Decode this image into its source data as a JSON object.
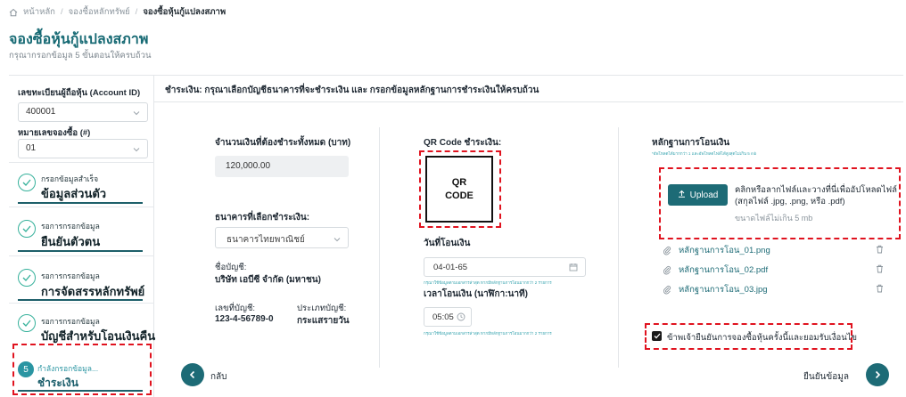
{
  "breadcrumb": {
    "home": "หน้าหลัก",
    "level2": "จองซื้อหลักทรัพย์",
    "current": "จองซื้อหุ้นกู้แปลงสภาพ"
  },
  "page": {
    "title": "จองซื้อหุ้นกู้แปลงสภาพ",
    "subtitle": "กรุณากรอกข้อมูล 5 ขั้นตอนให้ครบถ้วน"
  },
  "sidebar": {
    "account_label": "เลขทะเบียนผู้ถือหุ้น (Account ID)",
    "account_value": "400001",
    "order_label": "หมายเลขจองซื้อ (#)",
    "order_value": "01",
    "steps": [
      {
        "small": "กรอกข้อมูลสำเร็จ",
        "big": "ข้อมูลส่วนตัว"
      },
      {
        "small": "รอการกรอกข้อมูล",
        "big": "ยืนยันตัวตน"
      },
      {
        "small": "รอการกรอกข้อมูล",
        "big": "การจัดสรรหลักทรัพย์"
      },
      {
        "small": "รอการกรอกข้อมูล",
        "big": "บัญชีสำหรับโอนเงินคืน"
      }
    ],
    "active_step": {
      "number": "5",
      "small": "กำลังกรอกข้อมูล...",
      "big": "ชำระเงิน"
    }
  },
  "content": {
    "header": "ชำระเงิน: กรุณาเลือกบัญชีธนาคารที่จะชำระเงิน และ กรอกข้อมูลหลักฐานการชำระเงินให้ครบถ้วน",
    "amount_label": "จำนวนเงินที่ต้องชำระทั้งหมด (บาท)",
    "amount_value": "120,000.00",
    "bank_label": "ธนาคารที่เลือกชำระเงิน:",
    "bank_value": "ธนาคารไทยพาณิชย์",
    "account_name_label": "ชื่อบัญชี:",
    "account_name_value": "บริษัท เอบีซี จำกัด (มหาชน)",
    "account_no_label": "เลขที่บัญชี:",
    "account_no_value": "123-4-56789-0",
    "account_type_label": "ประเภทบัญชี:",
    "account_type_value": "กระแสรายวัน",
    "qr_label": "QR Code ชำระเงิน:",
    "qr_line1": "QR",
    "qr_line2": "CODE",
    "transfer_date_label": "วันที่โอนเงิน",
    "transfer_date_value": "04-01-65",
    "transfer_date_hint": "กรุณาใช้ข้อมูลตามเอกสารล่าสุด หากมีหลักฐานการโอนมากกว่า 2 รายการ",
    "transfer_time_label": "เวลาโอนเงิน (นาฬิกา:นาที)",
    "transfer_time_value": "05:05",
    "transfer_time_hint": "กรุณาใช้ข้อมูลตามเอกสารล่าสุด หากมีหลักฐานการโอนมากกว่า 2 รายการ",
    "evidence_label": "หลักฐานการโอนเงิน",
    "evidence_hint": "*อัพโหลดได้มากกว่า 1 และอัพโหลดไฟล์ได้สูงสุดไม่เกิน 5 mb",
    "upload_button": "Upload",
    "upload_text_1": "คลิกหรือลากไฟล์และวางที่นี่เพื่ออัปโหลดไฟล์",
    "upload_text_2": "(สกุลไฟล์ .jpg, .png, หรือ .pdf)",
    "upload_limit": "ขนาดไฟล์ไม่เกิน 5 mb",
    "files": [
      "หลักฐานการโอน_01.png",
      "หลักฐานการโอน_02.pdf",
      "หลักฐานการโอน_03.jpg"
    ],
    "confirm_text": "ข้าพเจ้ายืนยันการจองซื้อหุ้นครั้งนี้และยอมรับเงื่อนไข",
    "back_label": "กลับ",
    "next_label": "ยืนยันข้อมูล"
  },
  "colors": {
    "primary": "#1d6b76",
    "title": "#176a74",
    "success": "#36b19b",
    "annotation": "#e0131f"
  }
}
